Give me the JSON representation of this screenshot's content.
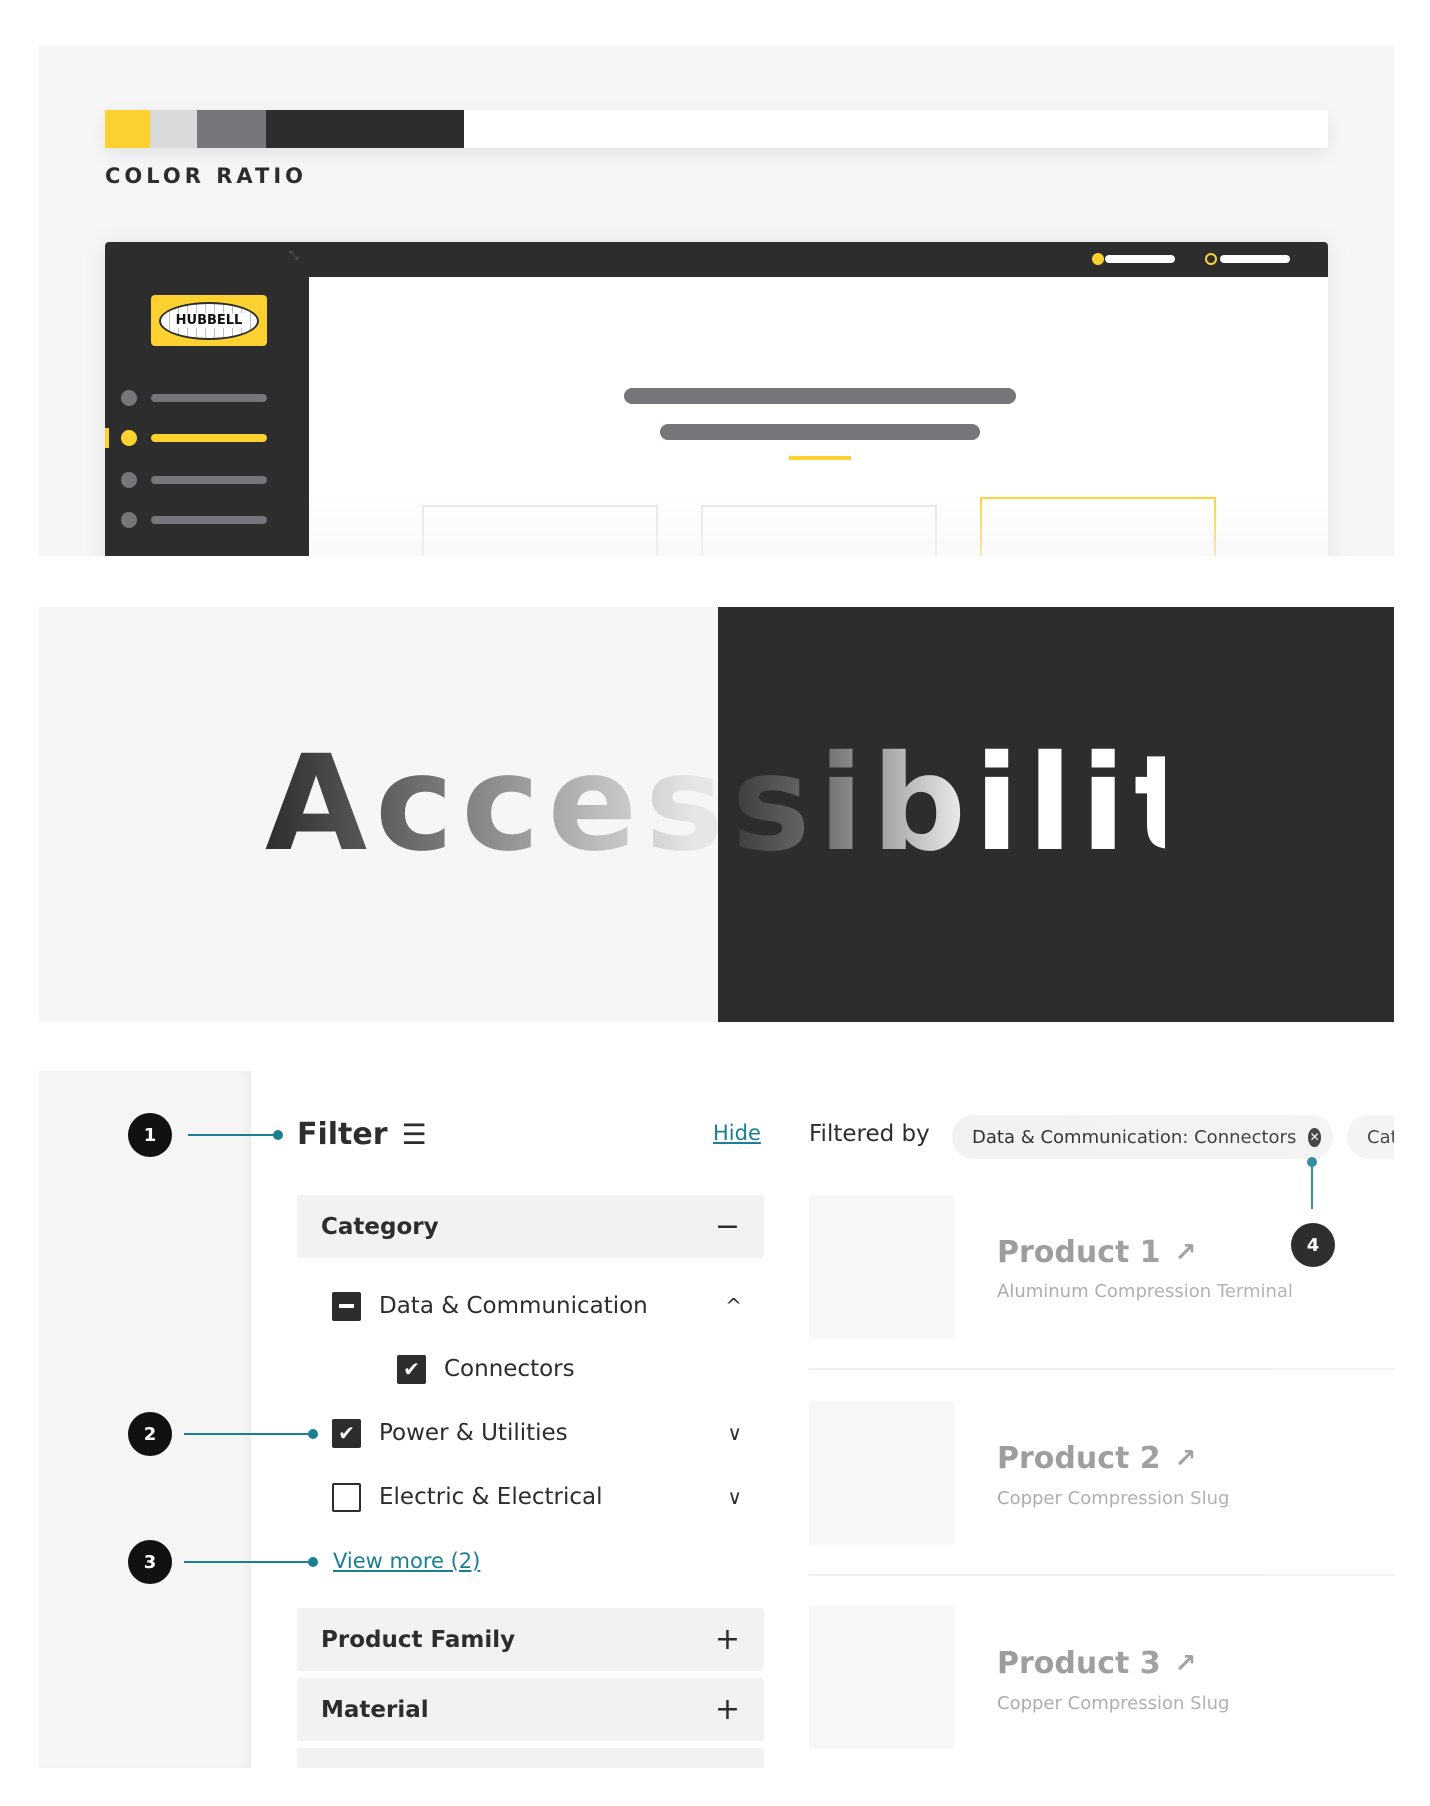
{
  "colors": {
    "yellow": "#fdd130",
    "light_gray": "#d9d9d9",
    "gray": "#75777a",
    "dark": "#2d2d2d",
    "white": "#ffffff",
    "teal": "#1a7f93"
  },
  "color_ratio": {
    "label": "COLOR RATIO",
    "segments": [
      {
        "color": "#fdd130",
        "fraction": 0.037
      },
      {
        "color": "#d9d9d9",
        "fraction": 0.039
      },
      {
        "color": "#75777a",
        "fraction": 0.056
      },
      {
        "color": "#2d2d2d",
        "fraction": 0.161
      },
      {
        "color": "#ffffff",
        "fraction": 0.707
      }
    ]
  },
  "mockup": {
    "logo_text": "HUBBELL",
    "nav_items": 4,
    "active_nav_index": 1,
    "collapse_icon": "collapse-arrows-icon"
  },
  "accessibility": {
    "title": "Accessibility"
  },
  "filter": {
    "title": "Filter",
    "filter_icon": "list-icon",
    "hide_label": "Hide",
    "filtered_by_label": "Filtered by",
    "chips": [
      {
        "label": "Data & Communication: Connectors",
        "icon": "close-circle-icon"
      },
      {
        "label": "Cat"
      }
    ],
    "sections": [
      {
        "label": "Category",
        "sign": "−"
      },
      {
        "label": "Product Family",
        "sign": "+"
      },
      {
        "label": "Material",
        "sign": "+"
      }
    ],
    "options": [
      {
        "label": "Data & Communication",
        "state": "indeterminate",
        "chevron": "^"
      },
      {
        "label": "Connectors",
        "state": "checked"
      },
      {
        "label": "Power & Utilities",
        "state": "checked",
        "chevron": "∨"
      },
      {
        "label": "Electric & Electrical",
        "state": "unchecked",
        "chevron": "∨"
      }
    ],
    "view_more": "View more (2)",
    "annotations": [
      "1",
      "2",
      "3",
      "4"
    ]
  },
  "products": [
    {
      "title": "Product 1",
      "subtitle": "Aluminum Compression Terminal"
    },
    {
      "title": "Product 2",
      "subtitle": "Copper Compression Slug"
    },
    {
      "title": "Product 3",
      "subtitle": "Copper Compression Slug"
    }
  ]
}
